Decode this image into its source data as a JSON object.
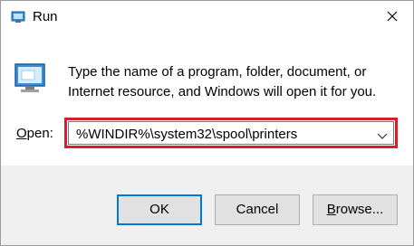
{
  "window": {
    "title": "Run",
    "close_icon": "close-icon",
    "app_icon": "run-app-icon"
  },
  "content": {
    "description": "Type the name of a program, folder, document, or Internet resource, and Windows will open it for you.",
    "open_label_accel": "O",
    "open_label_rest": "pen:",
    "open_value": "%WINDIR%\\system32\\spool\\printers",
    "highlight_color": "#d81e2c"
  },
  "buttons": {
    "ok": "OK",
    "cancel": "Cancel",
    "browse_accel": "B",
    "browse_rest": "rowse..."
  }
}
